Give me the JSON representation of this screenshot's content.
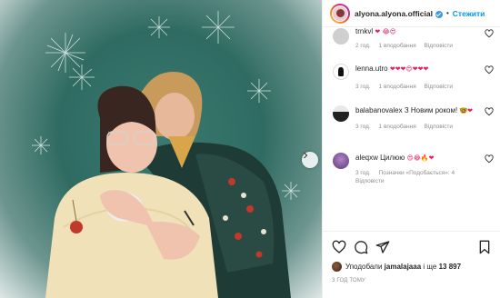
{
  "header": {
    "username": "alyona.alyona.official",
    "follow_label": "Стежити"
  },
  "comments": [
    {
      "user": "trnkvl",
      "text": "",
      "emoji": "❤ 😂😍",
      "time": "2 год.",
      "replies_label": "1 вподобання",
      "reply_label": "Відповісти"
    },
    {
      "user": "lenna.utro",
      "emoji": "❤❤❤😍❤❤❤",
      "time": "3 год.",
      "replies_label": "1 вподобання",
      "reply_label": "Відповісти"
    },
    {
      "user": "balabanovalex",
      "text": "З Новим роком!",
      "emoji": "🤓❤",
      "time": "3 год.",
      "replies_label": "1 вподобання",
      "reply_label": "Відповісти"
    },
    {
      "user": "aleqxw",
      "text": "Цилюю",
      "emoji": "😍😂🔥❤",
      "time": "3 год.",
      "likes_label": "Позначки «Подобається»: 4",
      "reply_label": "Відповісти"
    }
  ],
  "likes": {
    "prefix": "Уподобали",
    "user": "jamalajaaa",
    "and": "і ще",
    "count": "13 897"
  },
  "timestamp": "3 ГОД ТОМУ",
  "icons": [
    "more-icon",
    "heart-icon",
    "comment-icon",
    "share-icon",
    "bookmark-icon",
    "plus-circle-icon",
    "chevron-right-icon"
  ],
  "colors": {
    "accent": "#0095f6",
    "photo_bg": "#2f6b62",
    "heart_red": "#e0245e"
  }
}
